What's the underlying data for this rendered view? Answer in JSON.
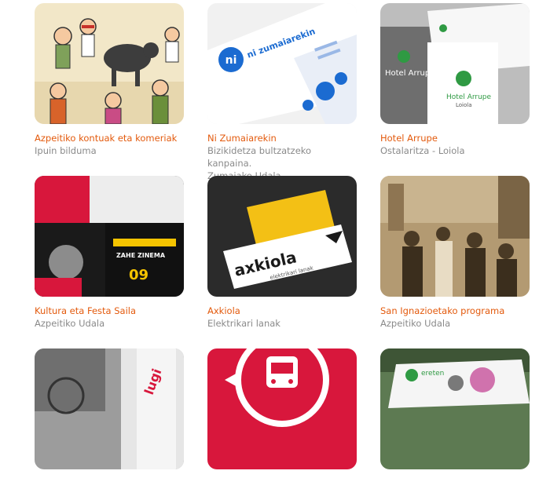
{
  "portfolio": {
    "items": [
      {
        "title": "Azpeitiko kontuak eta komeriak",
        "subtitle": "Ipuin bilduma",
        "subtitle2": ""
      },
      {
        "title": "Ni Zumaiarekin",
        "subtitle": "Bizikidetza bultzatzeko kanpaina.",
        "subtitle2": "Zumaiako Udala",
        "thumb_text": "ni zumaiarekin"
      },
      {
        "title": "Hotel Arrupe",
        "subtitle": "Ostalaritza - Loiola",
        "subtitle2": "",
        "thumb_text": "Hotel Arrupe",
        "thumb_text2": "Loiola"
      },
      {
        "title": "Kultura eta Festa Saila",
        "subtitle": "Azpeitiko Udala",
        "subtitle2": "",
        "thumb_text": "09",
        "thumb_text2": "ZAHE ZINEMA"
      },
      {
        "title": "Axkiola",
        "subtitle": "Elektrikari lanak",
        "subtitle2": "",
        "thumb_text": "axkiola",
        "thumb_text2": "elektrikari lanak"
      },
      {
        "title": "San Ignazioetako programa",
        "subtitle": "Azpeitiko Udala",
        "subtitle2": ""
      },
      {
        "title": "",
        "subtitle": "",
        "subtitle2": "",
        "thumb_text": "lugi"
      },
      {
        "title": "",
        "subtitle": "",
        "subtitle2": ""
      },
      {
        "title": "",
        "subtitle": "",
        "subtitle2": "",
        "thumb_text": "ereten"
      }
    ]
  },
  "colors": {
    "title": "#e35a0d",
    "subtitle": "#8a8a8a"
  }
}
